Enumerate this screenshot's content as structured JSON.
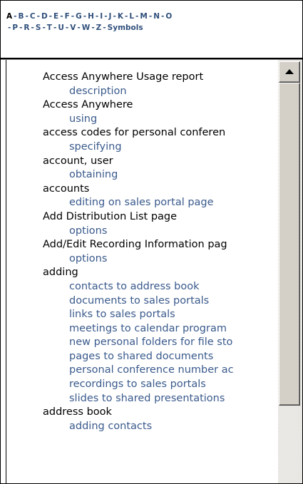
{
  "alphabet": {
    "row1": [
      "A",
      "B",
      "C",
      "D",
      "E",
      "F",
      "G",
      "H",
      "I",
      "J",
      "K",
      "L",
      "M",
      "N",
      "O"
    ],
    "row2": [
      "P",
      "R",
      "S",
      "T",
      "U",
      "V",
      "W",
      "Z",
      "Symbols"
    ],
    "current": "A",
    "separator": "-"
  },
  "index": [
    {
      "text": "Access Anywhere Usage report",
      "kind": "term"
    },
    {
      "text": "description",
      "kind": "sub"
    },
    {
      "text": "Access Anywhere",
      "kind": "term"
    },
    {
      "text": "using",
      "kind": "sub"
    },
    {
      "text": "access codes for personal conferen",
      "kind": "term"
    },
    {
      "text": "specifying",
      "kind": "sub"
    },
    {
      "text": "account, user",
      "kind": "term"
    },
    {
      "text": "obtaining",
      "kind": "sub"
    },
    {
      "text": "accounts",
      "kind": "term"
    },
    {
      "text": "editing on sales portal page",
      "kind": "sub"
    },
    {
      "text": "Add Distribution List page",
      "kind": "term"
    },
    {
      "text": "options",
      "kind": "sub"
    },
    {
      "text": "Add/Edit Recording Information pag",
      "kind": "term"
    },
    {
      "text": "options",
      "kind": "sub"
    },
    {
      "text": "adding",
      "kind": "term"
    },
    {
      "text": "contacts to address book",
      "kind": "sub"
    },
    {
      "text": "documents to sales portals",
      "kind": "sub"
    },
    {
      "text": "links to sales portals",
      "kind": "sub"
    },
    {
      "text": "meetings to calendar program",
      "kind": "sub"
    },
    {
      "text": "new personal folders for file sto",
      "kind": "sub"
    },
    {
      "text": "pages to shared documents",
      "kind": "sub"
    },
    {
      "text": "personal conference number ac",
      "kind": "sub"
    },
    {
      "text": "recordings to sales portals",
      "kind": "sub"
    },
    {
      "text": "slides to shared presentations",
      "kind": "sub"
    },
    {
      "text": "address book",
      "kind": "term"
    },
    {
      "text": "adding contacts",
      "kind": "sub"
    }
  ],
  "colors": {
    "link": "#3a5a8c",
    "alphabet_link": "#31507c",
    "term": "#000000",
    "scrollbar_face": "#d4d0c8"
  },
  "icons": {
    "scroll_up": "triangle-up"
  }
}
